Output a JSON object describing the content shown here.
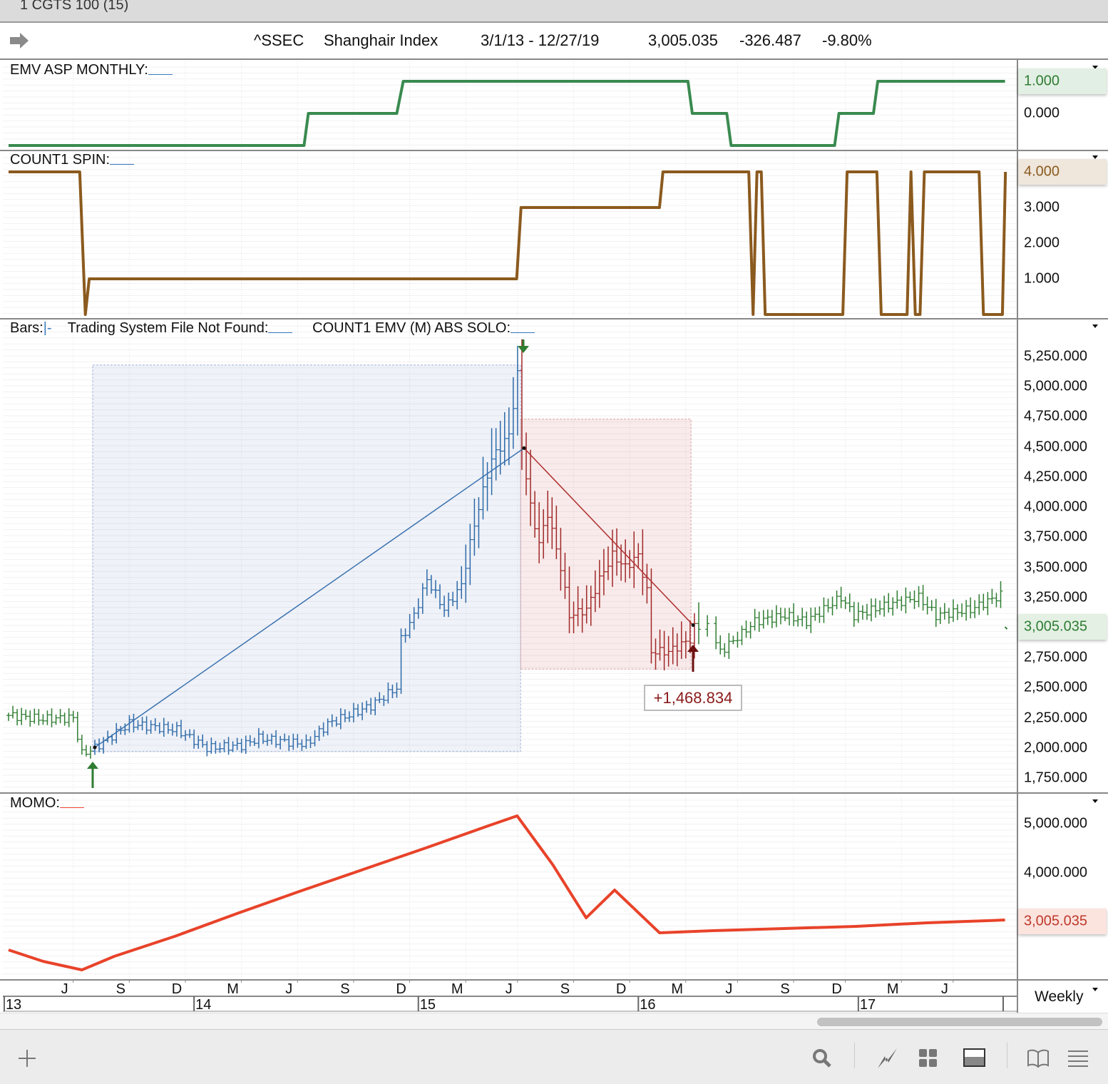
{
  "window": {
    "title": "1 CGTS 100 (15)"
  },
  "header": {
    "symbol": "^SSEC",
    "name": "Shanghair Index",
    "range": "3/1/13 - 12/27/19",
    "last": "3,005.035",
    "change": "-326.487",
    "pct": "-9.80%"
  },
  "panels": {
    "emv": {
      "label": "EMV ASP MONTHLY:",
      "ticks": [
        "1.000",
        "0.000"
      ],
      "color": "#3a8a4f"
    },
    "count": {
      "label": "COUNT1 SPIN:",
      "ticks": [
        "4.000",
        "3.000",
        "2.000",
        "1.000"
      ],
      "color": "#8b5a1e"
    },
    "price": {
      "label_bars": "Bars:",
      "bars_style": "|-",
      "label_ts": "Trading System File Not Found:",
      "label_solo": "COUNT1 EMV (M) ABS SOLO:",
      "ticks": [
        "5,250.000",
        "5,000.000",
        "4,750.000",
        "4,500.000",
        "4,250.000",
        "4,000.000",
        "3,750.000",
        "3,500.000",
        "3,250.000",
        "3,005.035",
        "2,750.000",
        "2,500.000",
        "2,250.000",
        "2,000.000",
        "1,750.000"
      ],
      "current": "3,005.035",
      "annotation": "+1,468.834"
    },
    "momo": {
      "label": "MOMO:",
      "ticks": [
        "5,000.000",
        "4,000.000",
        "3,005.035"
      ],
      "color": "#e8432a"
    }
  },
  "date_axis": {
    "months": [
      "J",
      "S",
      "D",
      "M",
      "J",
      "S",
      "D",
      "M",
      "J",
      "S",
      "D",
      "M",
      "J",
      "S",
      "D",
      "M",
      "J"
    ],
    "years": [
      "13",
      "14",
      "15",
      "16",
      "17"
    ],
    "period": "Weekly"
  },
  "chart_data": {
    "type": "line",
    "x_unit": "week index from start",
    "month_weeks": [
      13,
      26,
      39,
      52,
      65,
      78,
      91,
      104,
      116,
      129,
      142,
      155,
      167,
      180,
      192,
      205,
      217
    ],
    "year_weeks": [
      -1,
      43,
      95,
      146,
      197
    ],
    "emv_steps": [
      [
        0,
        -1
      ],
      [
        68.5,
        -1
      ],
      [
        69.5,
        0
      ],
      [
        90,
        0
      ],
      [
        91.5,
        1
      ],
      [
        157.5,
        1
      ],
      [
        158.5,
        0
      ],
      [
        166.5,
        0
      ],
      [
        167.5,
        -1
      ],
      [
        191.5,
        -1
      ],
      [
        192.5,
        0
      ],
      [
        200.5,
        0
      ],
      [
        201.5,
        1
      ],
      [
        231,
        1
      ]
    ],
    "count_steps": [
      [
        0,
        4
      ],
      [
        16.5,
        4
      ],
      [
        17.8,
        0
      ],
      [
        18.7,
        1
      ],
      [
        117.8,
        1
      ],
      [
        118.8,
        3
      ],
      [
        150.9,
        3
      ],
      [
        151.7,
        4
      ],
      [
        171.6,
        4
      ],
      [
        172.6,
        0
      ],
      [
        173.5,
        4
      ],
      [
        174.5,
        4
      ],
      [
        175.4,
        0
      ],
      [
        193.4,
        0
      ],
      [
        194.4,
        4
      ],
      [
        201.3,
        4
      ],
      [
        202.3,
        0
      ],
      [
        208.3,
        0
      ],
      [
        209.2,
        4
      ],
      [
        210.2,
        0
      ],
      [
        211.3,
        0
      ],
      [
        212.3,
        4
      ],
      [
        225,
        4
      ],
      [
        226,
        0
      ],
      [
        230.4,
        0
      ],
      [
        231.1,
        4
      ]
    ],
    "price_path": [
      [
        0,
        2270
      ],
      [
        8,
        2240
      ],
      [
        15,
        2250
      ],
      [
        17,
        1950
      ],
      [
        20,
        2000
      ],
      [
        28,
        2200
      ],
      [
        39,
        2150
      ],
      [
        46,
        2000
      ],
      [
        54,
        2020
      ],
      [
        58,
        2080
      ],
      [
        69,
        2030
      ],
      [
        74,
        2200
      ],
      [
        84,
        2350
      ],
      [
        90,
        2500
      ],
      [
        91,
        2900
      ],
      [
        94,
        3100
      ],
      [
        97,
        3400
      ],
      [
        101,
        3150
      ],
      [
        105,
        3350
      ],
      [
        107,
        3700
      ],
      [
        109,
        4000
      ],
      [
        112,
        4400
      ],
      [
        116,
        4600
      ],
      [
        118,
        5100
      ],
      [
        119,
        4500
      ],
      [
        121,
        4000
      ],
      [
        123,
        3700
      ],
      [
        125,
        3950
      ],
      [
        128,
        3500
      ],
      [
        130,
        3100
      ],
      [
        134,
        3150
      ],
      [
        137,
        3400
      ],
      [
        140,
        3600
      ],
      [
        143,
        3500
      ],
      [
        146,
        3600
      ],
      [
        148,
        3300
      ],
      [
        149,
        2800
      ],
      [
        153,
        2800
      ],
      [
        158,
        2900
      ],
      [
        159,
        3000
      ],
      [
        162,
        3000
      ],
      [
        165,
        2800
      ],
      [
        170,
        2950
      ],
      [
        173,
        3050
      ],
      [
        180,
        3100
      ],
      [
        185,
        3050
      ],
      [
        193,
        3250
      ],
      [
        196,
        3100
      ],
      [
        205,
        3200
      ],
      [
        211,
        3250
      ],
      [
        215,
        3100
      ],
      [
        223,
        3150
      ],
      [
        230,
        3270
      ]
    ],
    "segments": {
      "long_start": 20,
      "long_end": 118,
      "short_end": 159
    },
    "colors": {
      "pre": "#2f7d32",
      "long": "#2e6aa8",
      "short": "#a02828",
      "post": "#2f7d32"
    },
    "long_box": {
      "from_week": 19.5,
      "to_week": 118.7,
      "high": 5180,
      "low": 1970
    },
    "short_box": {
      "from_week": 118.7,
      "to_week": 158.2,
      "high": 4730,
      "low": 2655
    },
    "long_trend": [
      [
        20,
        2005
      ],
      [
        119.5,
        4490
      ]
    ],
    "short_trend": [
      [
        119.5,
        4490
      ],
      [
        158.7,
        3020
      ]
    ],
    "momo": [
      [
        0,
        2435
      ],
      [
        8,
        2203
      ],
      [
        17,
        2029
      ],
      [
        24.5,
        2304
      ],
      [
        38.5,
        2710
      ],
      [
        53.4,
        3188
      ],
      [
        67.4,
        3623
      ],
      [
        82.3,
        4072
      ],
      [
        97.2,
        4522
      ],
      [
        111.2,
        4957
      ],
      [
        117.9,
        5159
      ],
      [
        126.1,
        4174
      ],
      [
        133.9,
        3087
      ],
      [
        140.5,
        3652
      ],
      [
        150.9,
        2783
      ],
      [
        163.3,
        2826
      ],
      [
        179.8,
        2870
      ],
      [
        196.4,
        2913
      ],
      [
        212.9,
        2986
      ],
      [
        231,
        3043
      ]
    ],
    "price_ylim": [
      1750,
      5250
    ],
    "emv_ylim": [
      -1,
      1
    ],
    "count_ylim": [
      0,
      4
    ],
    "momo_ylim": [
      2000,
      5000
    ]
  }
}
